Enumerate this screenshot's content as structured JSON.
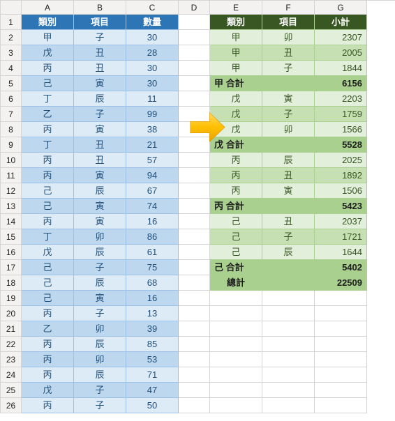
{
  "columns": [
    "A",
    "B",
    "C",
    "D",
    "E",
    "F",
    "G"
  ],
  "blue": {
    "headers": [
      "類別",
      "項目",
      "數量"
    ],
    "rows": [
      [
        "甲",
        "子",
        "30"
      ],
      [
        "戊",
        "丑",
        "28"
      ],
      [
        "丙",
        "丑",
        "30"
      ],
      [
        "己",
        "寅",
        "30"
      ],
      [
        "丁",
        "辰",
        "11"
      ],
      [
        "乙",
        "子",
        "99"
      ],
      [
        "丙",
        "寅",
        "38"
      ],
      [
        "丁",
        "丑",
        "21"
      ],
      [
        "丙",
        "丑",
        "57"
      ],
      [
        "丙",
        "寅",
        "94"
      ],
      [
        "己",
        "辰",
        "67"
      ],
      [
        "己",
        "寅",
        "74"
      ],
      [
        "丙",
        "寅",
        "16"
      ],
      [
        "丁",
        "卯",
        "86"
      ],
      [
        "戊",
        "辰",
        "61"
      ],
      [
        "己",
        "子",
        "75"
      ],
      [
        "己",
        "辰",
        "68"
      ],
      [
        "己",
        "寅",
        "16"
      ],
      [
        "丙",
        "子",
        "13"
      ],
      [
        "乙",
        "卯",
        "39"
      ],
      [
        "丙",
        "辰",
        "85"
      ],
      [
        "丙",
        "卯",
        "53"
      ],
      [
        "丙",
        "辰",
        "71"
      ],
      [
        "戊",
        "子",
        "47"
      ],
      [
        "丙",
        "子",
        "50"
      ]
    ]
  },
  "green": {
    "headers": [
      "類別",
      "項目",
      "小計"
    ],
    "rows": [
      {
        "t": "d",
        "v": [
          "甲",
          "卯",
          "2307"
        ]
      },
      {
        "t": "d",
        "v": [
          "甲",
          "丑",
          "2005"
        ]
      },
      {
        "t": "d",
        "v": [
          "甲",
          "子",
          "1844"
        ]
      },
      {
        "t": "s",
        "v": [
          "甲 合計",
          "",
          "6156"
        ]
      },
      {
        "t": "d",
        "v": [
          "戊",
          "寅",
          "2203"
        ]
      },
      {
        "t": "d",
        "v": [
          "戊",
          "子",
          "1759"
        ]
      },
      {
        "t": "d",
        "v": [
          "戊",
          "卯",
          "1566"
        ]
      },
      {
        "t": "s",
        "v": [
          "戊 合計",
          "",
          "5528"
        ]
      },
      {
        "t": "d",
        "v": [
          "丙",
          "辰",
          "2025"
        ]
      },
      {
        "t": "d",
        "v": [
          "丙",
          "丑",
          "1892"
        ]
      },
      {
        "t": "d",
        "v": [
          "丙",
          "寅",
          "1506"
        ]
      },
      {
        "t": "s",
        "v": [
          "丙 合計",
          "",
          "5423"
        ]
      },
      {
        "t": "d",
        "v": [
          "己",
          "丑",
          "2037"
        ]
      },
      {
        "t": "d",
        "v": [
          "己",
          "子",
          "1721"
        ]
      },
      {
        "t": "d",
        "v": [
          "己",
          "辰",
          "1644"
        ]
      },
      {
        "t": "s",
        "v": [
          "己 合計",
          "",
          "5402"
        ]
      },
      {
        "t": "t",
        "v": [
          "總計",
          "",
          "22509"
        ]
      }
    ]
  }
}
